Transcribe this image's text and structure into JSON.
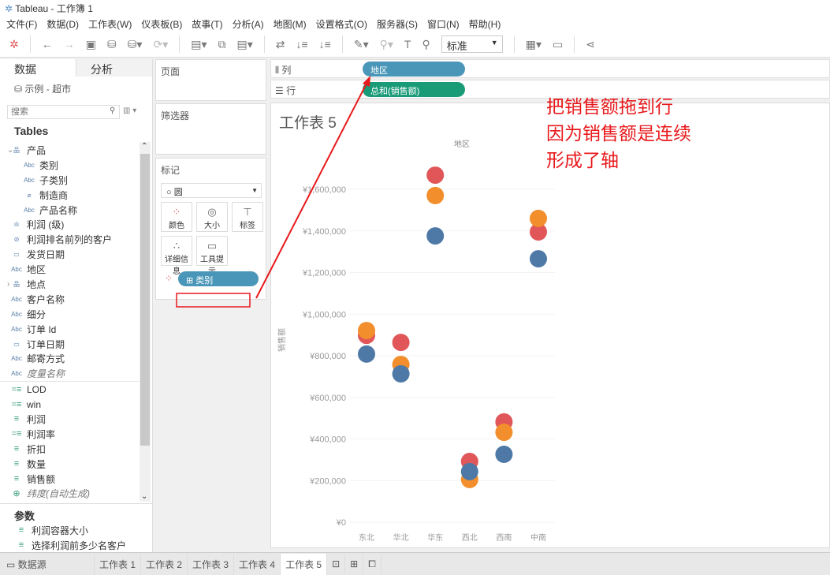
{
  "window": {
    "title": "Tableau - 工作簿 1"
  },
  "menu": [
    "文件(F)",
    "数据(D)",
    "工作表(W)",
    "仪表板(B)",
    "故事(T)",
    "分析(A)",
    "地图(M)",
    "设置格式(O)",
    "服务器(S)",
    "窗口(N)",
    "帮助(H)"
  ],
  "toolbar": {
    "fit_select": "标准"
  },
  "data_panel": {
    "tab_data": "数据",
    "tab_analysis": "分析",
    "datasource": "示例 - 超市",
    "search_placeholder": "搜索",
    "tables_heading": "Tables",
    "fields": [
      {
        "label": "产品",
        "icon": "hierarchy",
        "indent": 0,
        "expand": "⌄"
      },
      {
        "label": "类别",
        "icon": "abc",
        "indent": 1
      },
      {
        "label": "子类别",
        "icon": "abc",
        "indent": 1
      },
      {
        "label": "制造商",
        "icon": "clip",
        "indent": 1
      },
      {
        "label": "产品名称",
        "icon": "abc",
        "indent": 1
      },
      {
        "label": "利润 (级)",
        "icon": "bins",
        "indent": 0
      },
      {
        "label": "利润排名前列的客户",
        "icon": "set",
        "indent": 0
      },
      {
        "label": "发货日期",
        "icon": "date",
        "indent": 0
      },
      {
        "label": "地区",
        "icon": "abc",
        "indent": 0
      },
      {
        "label": "地点",
        "icon": "hierarchy",
        "indent": 0,
        "expand": "›"
      },
      {
        "label": "客户名称",
        "icon": "abc",
        "indent": 0
      },
      {
        "label": "细分",
        "icon": "abc",
        "indent": 0
      },
      {
        "label": "订单 Id",
        "icon": "abc",
        "indent": 0
      },
      {
        "label": "订单日期",
        "icon": "date",
        "indent": 0
      },
      {
        "label": "邮寄方式",
        "icon": "abc",
        "indent": 0
      },
      {
        "label": "度量名称",
        "icon": "abc",
        "indent": 0,
        "italic": true
      },
      {
        "label": "LOD",
        "icon": "calc-measure",
        "indent": 0
      },
      {
        "label": "win",
        "icon": "calc-measure",
        "indent": 0
      },
      {
        "label": "利润",
        "icon": "measure",
        "indent": 0
      },
      {
        "label": "利润率",
        "icon": "calc-measure",
        "indent": 0
      },
      {
        "label": "折扣",
        "icon": "measure",
        "indent": 0
      },
      {
        "label": "数量",
        "icon": "measure",
        "indent": 0
      },
      {
        "label": "销售额",
        "icon": "measure",
        "indent": 0
      },
      {
        "label": "纬度(自动生成)",
        "icon": "geo",
        "indent": 0,
        "italic": true
      }
    ],
    "params_heading": "参数",
    "params": [
      "利润容器大小",
      "选择利润前多少名客户"
    ]
  },
  "cards": {
    "pages": "页面",
    "filters": "筛选器",
    "marks": "标记",
    "mark_type": "圆",
    "buttons": [
      "颜色",
      "大小",
      "标签",
      "详细信息",
      "工具提示"
    ],
    "color_pill": "类别"
  },
  "shelves": {
    "columns_label": "列",
    "columns_pill": "地区",
    "rows_label": "行",
    "rows_pill": "总和(销售额)"
  },
  "sheet": {
    "title": "工作表 5"
  },
  "annotation": [
    "把销售额拖到行",
    "因为销售额是连续",
    "形成了轴"
  ],
  "colors": {
    "blue": "#4e79a7",
    "orange": "#f28e2b",
    "red": "#e15759",
    "column_pill": "#4a96b8",
    "row_pill": "#1a9b78",
    "annotation": "#e8191c"
  },
  "chart_data": {
    "type": "scatter",
    "xlabel_top": "地区",
    "ylabel": "销售额",
    "categories": [
      "东北",
      "华北",
      "华东",
      "西北",
      "西南",
      "中南"
    ],
    "ylim": [
      0,
      1600000
    ],
    "yticks": [
      "¥0",
      "¥200,000",
      "¥400,000",
      "¥600,000",
      "¥800,000",
      "¥1,000,000",
      "¥1,200,000",
      "¥1,400,000",
      "¥1,600,000"
    ],
    "series": [
      {
        "color": "#e15759",
        "values": [
          898000,
          864000,
          1668000,
          292000,
          482000,
          1395000
        ]
      },
      {
        "color": "#f28e2b",
        "values": [
          921000,
          758000,
          1570000,
          205000,
          432000,
          1460000
        ]
      },
      {
        "color": "#4e79a7",
        "values": [
          808000,
          713000,
          1376000,
          243000,
          326000,
          1266000
        ]
      }
    ]
  },
  "sheet_tabs": {
    "datasource": "数据源",
    "tabs": [
      "工作表 1",
      "工作表 2",
      "工作表 3",
      "工作表 4",
      "工作表 5"
    ],
    "active": 4
  }
}
